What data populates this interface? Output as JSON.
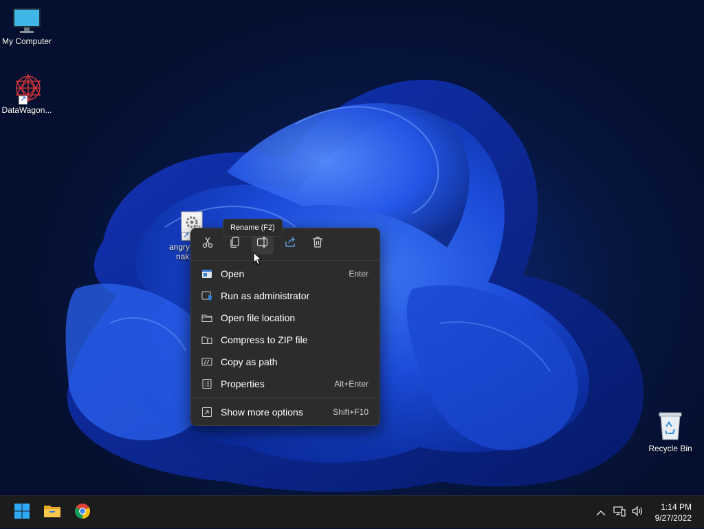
{
  "desktop": {
    "icons": [
      {
        "label": "My Computer",
        "icon": "monitor-icon"
      },
      {
        "label": "DataWagon...",
        "icon": "datawagon-logo-icon"
      },
      {
        "label_line1": "angry",
        "label_line2": "nak",
        "icon": "settings-file-icon"
      },
      {
        "label": "Recycle Bin",
        "icon": "recycle-bin-icon"
      }
    ]
  },
  "tooltip": {
    "text": "Rename (F2)"
  },
  "context_menu": {
    "toolbar": [
      {
        "icon": "cut-icon",
        "active": false
      },
      {
        "icon": "copy-icon",
        "active": false
      },
      {
        "icon": "rename-icon",
        "active": true
      },
      {
        "icon": "share-icon",
        "active": false
      },
      {
        "icon": "delete-icon",
        "active": false
      }
    ],
    "items": [
      {
        "label": "Open",
        "shortcut": "Enter",
        "icon": "open-app-icon"
      },
      {
        "label": "Run as administrator",
        "shortcut": "",
        "icon": "admin-shield-icon"
      },
      {
        "label": "Open file location",
        "shortcut": "",
        "icon": "folder-icon"
      },
      {
        "label": "Compress to ZIP file",
        "shortcut": "",
        "icon": "zip-folder-icon"
      },
      {
        "label": "Copy as path",
        "shortcut": "",
        "icon": "copy-path-icon"
      },
      {
        "label": "Properties",
        "shortcut": "Alt+Enter",
        "icon": "properties-icon"
      }
    ],
    "more": {
      "label": "Show more options",
      "shortcut": "Shift+F10",
      "icon": "more-options-icon"
    }
  },
  "taskbar": {
    "apps": [
      {
        "icon": "windows-start-icon"
      },
      {
        "icon": "file-explorer-icon"
      },
      {
        "icon": "chrome-icon"
      }
    ],
    "tray": [
      "chevron-up-icon",
      "network-icon",
      "volume-icon"
    ],
    "clock": {
      "time": "1:14 PM",
      "date": "9/27/2022"
    }
  },
  "colors": {
    "menu_bg": "#2c2c2c",
    "taskbar_bg": "#1c1c1c",
    "accent": "#0078d4"
  }
}
